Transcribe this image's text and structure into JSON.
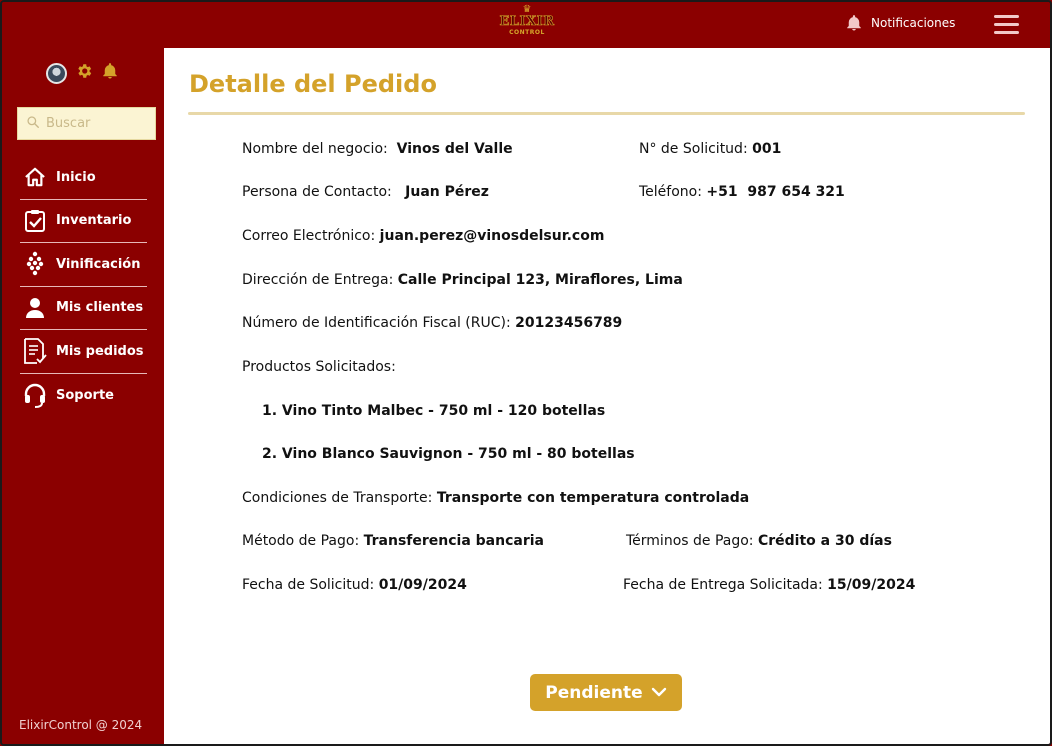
{
  "header": {
    "logo_text": "ELIXIR",
    "logo_sub": "CONTROL",
    "notifications_label": "Notificaciones"
  },
  "sidebar": {
    "search_placeholder": "Buscar",
    "items": [
      {
        "label": "Inicio",
        "icon": "home-icon"
      },
      {
        "label": "Inventario",
        "icon": "clipboard-check-icon"
      },
      {
        "label": "Vinificación",
        "icon": "grapes-icon"
      },
      {
        "label": "Mis clientes",
        "icon": "user-icon"
      },
      {
        "label": "Mis pedidos",
        "icon": "document-icon"
      },
      {
        "label": "Soporte",
        "icon": "headset-icon"
      }
    ],
    "footer": "ElixirControl @ 2024"
  },
  "main": {
    "title": "Detalle del Pedido",
    "business_name_label": "Nombre del negocio:",
    "business_name": "Vinos del Valle",
    "request_no_label": "N° de Solicitud:",
    "request_no": "001",
    "contact_label": "Persona de Contacto:",
    "contact": "Juan Pérez",
    "phone_label": "Teléfono:",
    "phone": "+51  987 654 321",
    "email_label": "Correo Electrónico:",
    "email": "juan.perez@vinosdelsur.com",
    "address_label": "Dirección de Entrega:",
    "address": "Calle Principal 123, Miraflores, Lima",
    "ruc_label": "Número de Identificación Fiscal (RUC):",
    "ruc": "20123456789",
    "products_label": "Productos Solicitados:",
    "products": [
      "1. Vino Tinto Malbec - 750 ml - 120 botellas",
      "2. Vino Blanco Sauvignon - 750 ml - 80 botellas"
    ],
    "transport_label": "Condiciones de Transporte:",
    "transport": "Transporte con temperatura controlada",
    "payment_method_label": "Método de Pago:",
    "payment_method": "Transferencia bancaria",
    "payment_terms_label": "Términos de Pago:",
    "payment_terms": "Crédito a 30 días",
    "request_date_label": "Fecha de Solicitud:",
    "request_date": "01/09/2024",
    "delivery_date_label": "Fecha de Entrega Solicitada:",
    "delivery_date": "15/09/2024",
    "status": "Pendiente"
  },
  "colors": {
    "brand_red": "#8b0000",
    "accent_gold": "#d4a22a"
  }
}
